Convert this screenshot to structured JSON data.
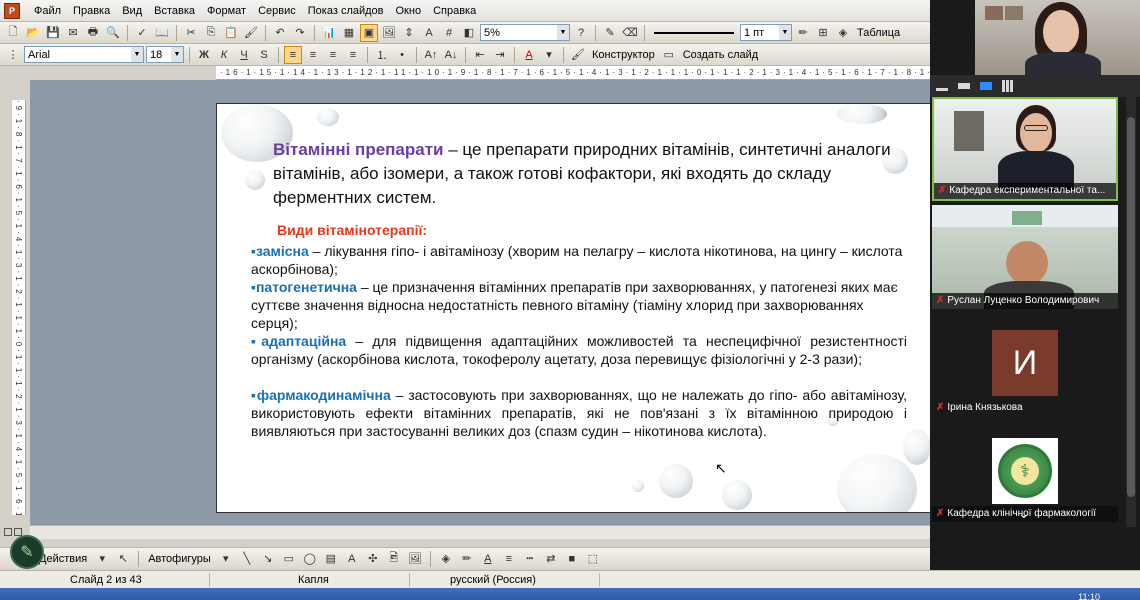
{
  "menubar": {
    "items": [
      "Файл",
      "Правка",
      "Вид",
      "Вставка",
      "Формат",
      "Сервис",
      "Показ слайдов",
      "Окно",
      "Справка"
    ]
  },
  "toolbar1": {
    "zoom_value": "5%",
    "line_weight": "1 пт",
    "table_label": "Таблица"
  },
  "toolbar2": {
    "font_name": "Arial",
    "font_size": "18",
    "bold": "Ж",
    "italic": "К",
    "underline": "Ч",
    "shadow": "S",
    "designer_label": "Конструктор",
    "new_slide_label": "Создать слайд"
  },
  "ruler": {
    "h_ticks": "·16·1·15·1·14·1·13·1·12·1·11·1·10·1·9·1·8·1·7·1·6·1·5·1·4·1·3·1·2·1·1·1·0·1·1·1·2·1·3·1·4·1·5·1·6·1·7·1·8·1·9·1·10·1·11·1·12·1·13·1·14·1·15·1·16",
    "v_ticks": "·9·1·8·1·7·1·6·1·5·1·4·1·3·1·2·1·1·1·0·1·1·1·2·1·3·1·4·1·5·1·6·1·7·1·8·1·9"
  },
  "slide": {
    "heading_term": "Вітамінні препарати",
    "heading_rest": " – це препарати природних вітамінів, синтетичні аналоги вітамінів, або ізомери, а також готові кофактори, які входять до складу ферментних систем.",
    "section_title": "Види вітамінотерапії:",
    "items": [
      {
        "bullet": "▪",
        "term": "замісна",
        "text": " –  лікування гіпо- і авітамінозу (хворим на пелагру – кислота нікотинова, на цингу – кислота аскорбінова);"
      },
      {
        "bullet": "▪",
        "term": "патогенетична",
        "text": " – це призначення вітамінних препаратів при захворюваннях, у патогенезі яких має суттєве значення відносна недостатність певного вітаміну (тіаміну хлорид при захворюваннях серця);"
      },
      {
        "bullet": "▪",
        "term": "адаптаційна",
        "text": " – для підвищення адаптаційних можливостей та неспецифічної резистентності організму (аскорбінова кислота, токоферолу ацетату, доза перевищує фізіологічні у 2-3 рази);"
      },
      {
        "bullet": "▪",
        "term": "фармакодинамічна",
        "text": " – застосовують при захворюваннях, що не належать до гіпо- або авітамінозу,  використовують ефекти вітамінних препаратів, які не пов'язані з їх вітамінною природою і виявляються при застосуванні великих доз (спазм судин – нікотинова кислота)."
      }
    ]
  },
  "drawing_toolbar": {
    "actions_label": "Действия",
    "autoshapes_label": "Автофигуры"
  },
  "statusbar": {
    "slide_counter": "Слайд 2 из 43",
    "design": "Капля",
    "language": "русский (Россия)"
  },
  "taskbar": {
    "clock": "11:10"
  },
  "zoom": {
    "participants": [
      {
        "name": "Кафедра експериментальної та...",
        "muted": true
      },
      {
        "name": "Руслан Луценко Володимирович",
        "muted": true
      },
      {
        "name": "Ірина Князькова",
        "muted": true,
        "avatar_letter": "И"
      },
      {
        "name": "Кафедра клінічної фармакології",
        "muted": true
      }
    ],
    "colors": {
      "active_speaker_border": "#7cc242",
      "avatar_bg": "#7b3b2a"
    }
  }
}
